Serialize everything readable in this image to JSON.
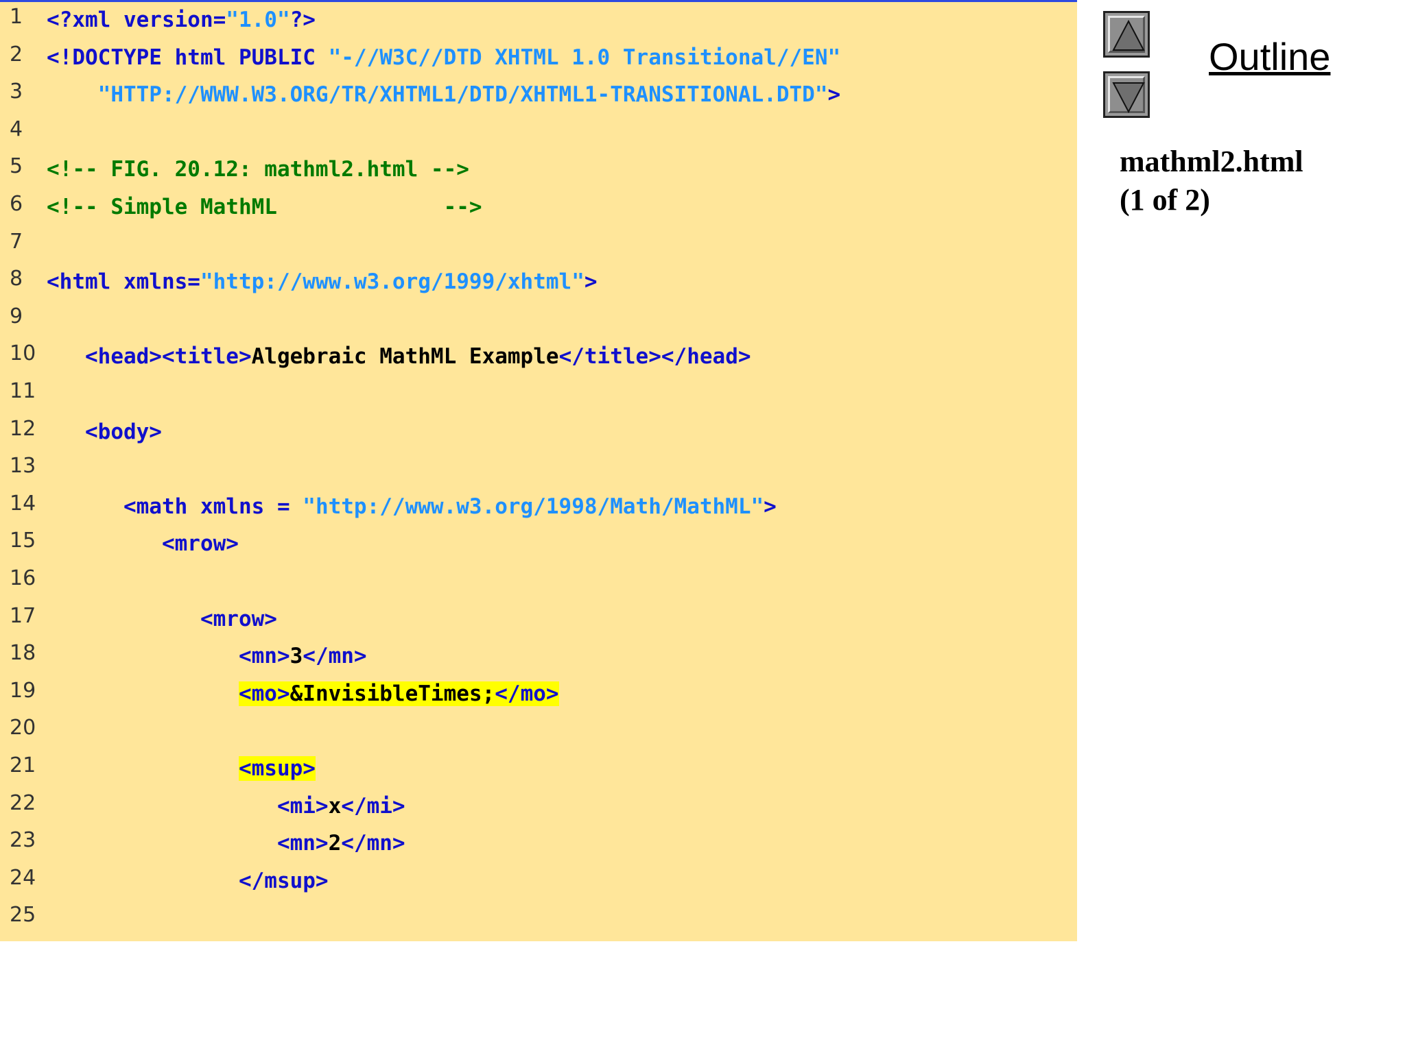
{
  "outline": {
    "title": "Outline",
    "file_name": "mathml2.html",
    "page_info": "(1 of 2)",
    "up_button": "up-arrow-icon",
    "down_button": "down-arrow-icon"
  },
  "code_lines": [
    {
      "n": "1",
      "segs": [
        {
          "c": "tag",
          "t": "<?xml version="
        },
        {
          "c": "str",
          "t": "\"1.0\""
        },
        {
          "c": "tag",
          "t": "?>"
        }
      ]
    },
    {
      "n": "2",
      "segs": [
        {
          "c": "tag",
          "t": "<!DOCTYPE html PUBLIC "
        },
        {
          "c": "str",
          "t": "\"-//W3C//DTD XHTML 1.0 Transitional//EN\""
        }
      ]
    },
    {
      "n": "3",
      "segs": [
        {
          "c": "str",
          "t": "    \"HTTP://WWW.W3.ORG/TR/XHTML1/DTD/XHTML1-TRANSITIONAL.DTD\""
        },
        {
          "c": "tag",
          "t": ">"
        }
      ]
    },
    {
      "n": "4",
      "segs": []
    },
    {
      "n": "5",
      "segs": [
        {
          "c": "cmt",
          "t": "<!-- FIG. 20.12: mathml2.html -->"
        }
      ]
    },
    {
      "n": "6",
      "segs": [
        {
          "c": "cmt",
          "t": "<!-- Simple MathML             -->"
        }
      ]
    },
    {
      "n": "7",
      "segs": []
    },
    {
      "n": "8",
      "segs": [
        {
          "c": "tag",
          "t": "<html xmlns="
        },
        {
          "c": "str",
          "t": "\"http://www.w3.org/1999/xhtml\""
        },
        {
          "c": "tag",
          "t": ">"
        }
      ]
    },
    {
      "n": "9",
      "segs": []
    },
    {
      "n": "10",
      "segs": [
        {
          "c": "tag",
          "t": "   <head><title>"
        },
        {
          "c": "txt",
          "t": "Algebraic MathML Example"
        },
        {
          "c": "tag",
          "t": "</title></head>"
        }
      ]
    },
    {
      "n": "11",
      "segs": []
    },
    {
      "n": "12",
      "segs": [
        {
          "c": "tag",
          "t": "   <body>"
        }
      ]
    },
    {
      "n": "13",
      "segs": []
    },
    {
      "n": "14",
      "segs": [
        {
          "c": "tag",
          "t": "      <math xmlns = "
        },
        {
          "c": "str",
          "t": "\"http://www.w3.org/1998/Math/MathML\""
        },
        {
          "c": "tag",
          "t": ">"
        }
      ]
    },
    {
      "n": "15",
      "segs": [
        {
          "c": "tag",
          "t": "         <mrow>"
        }
      ]
    },
    {
      "n": "16",
      "segs": []
    },
    {
      "n": "17",
      "segs": [
        {
          "c": "tag",
          "t": "            <mrow>"
        }
      ]
    },
    {
      "n": "18",
      "segs": [
        {
          "c": "tag",
          "t": "               <mn>"
        },
        {
          "c": "txt",
          "t": "3"
        },
        {
          "c": "tag",
          "t": "</mn>"
        }
      ]
    },
    {
      "n": "19",
      "segs": [
        {
          "c": "tag",
          "t": "               "
        },
        {
          "c": "tag hl",
          "t": "<mo>"
        },
        {
          "c": "txt hl",
          "t": "&InvisibleTimes;"
        },
        {
          "c": "tag hl",
          "t": "</mo>"
        }
      ]
    },
    {
      "n": "20",
      "segs": []
    },
    {
      "n": "21",
      "segs": [
        {
          "c": "tag",
          "t": "               "
        },
        {
          "c": "tag hl",
          "t": "<msup>"
        }
      ]
    },
    {
      "n": "22",
      "segs": [
        {
          "c": "tag",
          "t": "                  <mi>"
        },
        {
          "c": "txt",
          "t": "x"
        },
        {
          "c": "tag",
          "t": "</mi>"
        }
      ]
    },
    {
      "n": "23",
      "segs": [
        {
          "c": "tag",
          "t": "                  <mn>"
        },
        {
          "c": "txt",
          "t": "2"
        },
        {
          "c": "tag",
          "t": "</mn>"
        }
      ]
    },
    {
      "n": "24",
      "segs": [
        {
          "c": "tag",
          "t": "               </msup>"
        }
      ]
    },
    {
      "n": "25",
      "segs": []
    }
  ]
}
